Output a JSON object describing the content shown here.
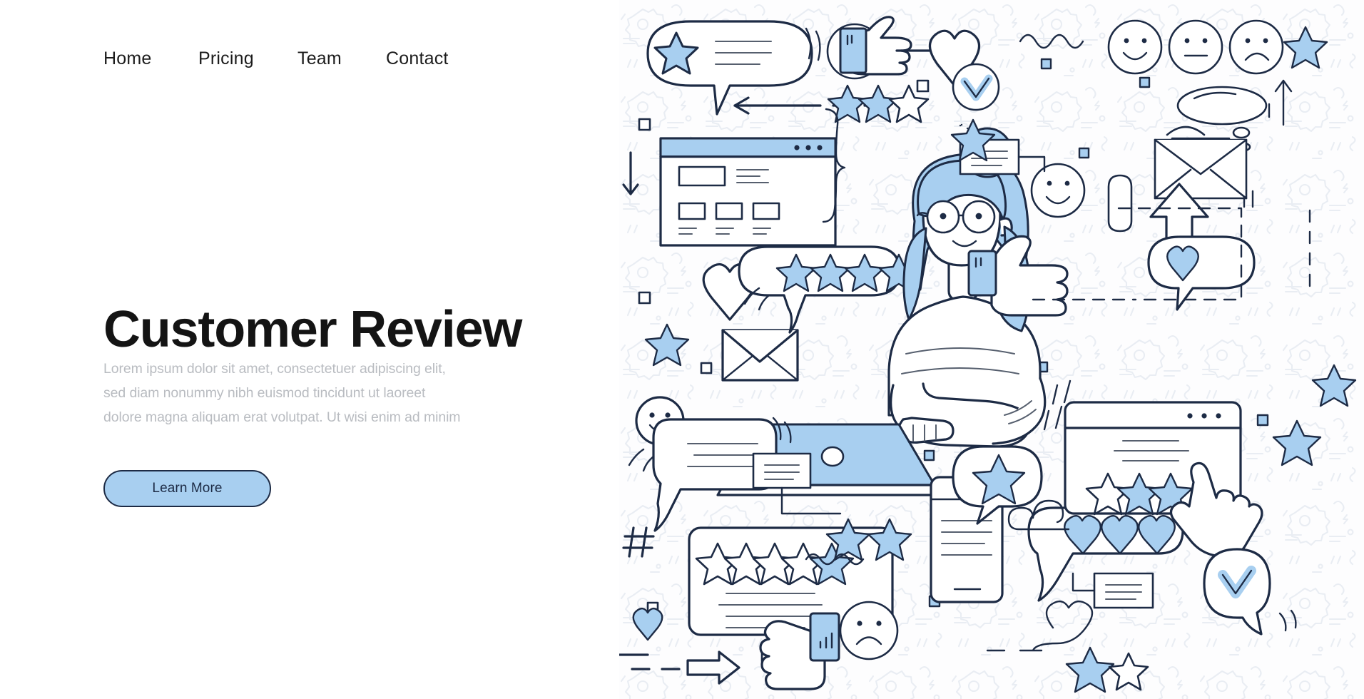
{
  "nav": {
    "items": [
      {
        "label": "Home"
      },
      {
        "label": "Pricing"
      },
      {
        "label": "Team"
      },
      {
        "label": "Contact"
      }
    ]
  },
  "hero": {
    "title": "Customer Review",
    "body_lines": [
      "Lorem ipsum dolor sit amet, consectetuer adipiscing elit,",
      "sed diam nonummy nibh euismod tincidunt ut laoreet",
      "dolore magna aliquam erat volutpat. Ut wisi enim ad minim"
    ],
    "cta_label": "Learn More"
  },
  "colors": {
    "accent_blue": "#a8cff0",
    "outline_navy": "#1d2b45",
    "title_black": "#141414",
    "body_gray": "#b9bcc1",
    "pattern_gray": "#e9edf3",
    "panel_bg": "#fdfdfe"
  },
  "illustration": {
    "title": "Customer review doodle illustration",
    "character": {
      "name": "woman-at-laptop",
      "hair_color": "#a8cff0",
      "description": "Woman with blue hair in a bun wearing round glasses typing on a blue laptop"
    },
    "elements": [
      {
        "name": "speech-bubble-star-lines",
        "position": "top-left"
      },
      {
        "name": "neutral-face-icon",
        "position": "top-left-center"
      },
      {
        "name": "pointing-hand-icon",
        "position": "top-center"
      },
      {
        "name": "heart-outline-icon",
        "position": "top-center"
      },
      {
        "name": "star-rating-three",
        "position": "top-center",
        "filled": 2,
        "total": 3
      },
      {
        "name": "check-circle-icon",
        "position": "top-center-right"
      },
      {
        "name": "squiggle-line",
        "position": "top-right"
      },
      {
        "name": "happy-face-icon",
        "position": "top-right"
      },
      {
        "name": "neutral-face-icon-2",
        "position": "top-right"
      },
      {
        "name": "sad-face-icon",
        "position": "top-right"
      },
      {
        "name": "star-blue-icon",
        "position": "top-right-corner"
      },
      {
        "name": "thought-bubble-icon",
        "position": "upper-right"
      },
      {
        "name": "up-arrow-icon",
        "position": "upper-right"
      },
      {
        "name": "envelope-heart-icon",
        "position": "upper-right"
      },
      {
        "name": "browser-window-wireframe",
        "position": "left"
      },
      {
        "name": "down-arrow-icon",
        "position": "left"
      },
      {
        "name": "left-arrow-dashed",
        "position": "top-center"
      },
      {
        "name": "note-card-connector",
        "position": "upper-right-center"
      },
      {
        "name": "star-rating-bubble-four",
        "position": "center-left",
        "filled": 4,
        "total": 4
      },
      {
        "name": "heart-outline-small",
        "position": "center-left"
      },
      {
        "name": "envelope-icon",
        "position": "center-left"
      },
      {
        "name": "star-blue-small",
        "position": "center-left"
      },
      {
        "name": "smiley-speech-bubble",
        "position": "center-left-lower"
      },
      {
        "name": "hash-icon",
        "position": "bottom-left"
      },
      {
        "name": "heart-blue-small",
        "position": "bottom-left"
      },
      {
        "name": "right-arrow-dashed",
        "position": "bottom-left"
      },
      {
        "name": "review-card-stars",
        "position": "bottom-center",
        "filled": 1,
        "total": 5
      },
      {
        "name": "thumbs-down-icon",
        "position": "bottom-center"
      },
      {
        "name": "thumbs-up-icon",
        "position": "center-right"
      },
      {
        "name": "smiley-face-icon",
        "position": "center-right"
      },
      {
        "name": "exclamation-mark-icon",
        "position": "center-right"
      },
      {
        "name": "up-arrow-solid-icon",
        "position": "center-right"
      },
      {
        "name": "heart-speech-bubble",
        "position": "center-right"
      },
      {
        "name": "phone-star-bubble",
        "position": "bottom-center-right"
      },
      {
        "name": "hearts-speech-bubble-three",
        "position": "bottom-right",
        "count": 3
      },
      {
        "name": "sad-face-icon-2",
        "position": "bottom-center"
      },
      {
        "name": "wave-line-icon",
        "position": "bottom-center"
      },
      {
        "name": "browser-window-stars",
        "position": "bottom-right",
        "filled": 2,
        "total": 3
      },
      {
        "name": "hand-cursor-icon",
        "position": "bottom-right"
      },
      {
        "name": "check-speech-bubble",
        "position": "bottom-right-corner"
      },
      {
        "name": "note-card-small",
        "position": "bottom-right"
      },
      {
        "name": "star-pair-bottom",
        "position": "bottom-right",
        "filled": 1,
        "total": 2
      },
      {
        "name": "dashed-rectangle-path",
        "position": "center-right"
      },
      {
        "name": "star-rating-pair-center",
        "position": "bottom-center",
        "filled": 2,
        "total": 2
      }
    ]
  }
}
